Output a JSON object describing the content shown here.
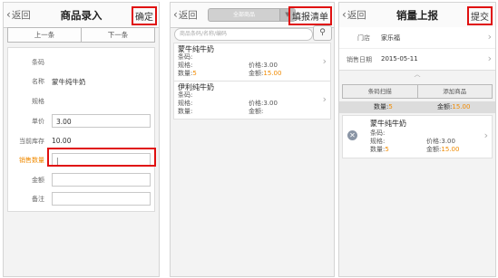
{
  "common": {
    "back_label": "返回"
  },
  "p1": {
    "title": "商品录入",
    "confirm_label": "确定",
    "prev_label": "上一条",
    "next_label": "下一条",
    "fields": {
      "barcode_label": "条码",
      "name_label": "名称",
      "name_value": "蒙牛纯牛奶",
      "spec_label": "规格",
      "price_label": "单价",
      "price_value": "3.00",
      "stock_label": "当前库存",
      "stock_value": "10.00",
      "qty_label": "销售数量",
      "amount_label": "金额",
      "note_label": "备注"
    }
  },
  "p2": {
    "filter_label": "全部商品",
    "submit_label": "填报清单",
    "search_placeholder": "商品条码/名称/编码",
    "items": [
      {
        "name": "蒙牛纯牛奶",
        "barcode_label": "条码:",
        "spec_label": "规格:",
        "qty_label": "数量:",
        "qty": "5",
        "price_label": "价格:",
        "price": "3.00",
        "amount_label": "金额:",
        "amount": "15.00"
      },
      {
        "name": "伊利纯牛奶",
        "barcode_label": "条码:",
        "spec_label": "规格:",
        "qty_label": "数量:",
        "qty": "",
        "price_label": "价格:",
        "price": "3.00",
        "amount_label": "金额:",
        "amount": ""
      }
    ]
  },
  "p3": {
    "title": "销量上报",
    "submit_label": "提交",
    "store_label": "门店",
    "store_value": "家乐福",
    "date_label": "销售日期",
    "date_value": "2015-05-11",
    "scan_label": "条码扫描",
    "add_label": "添加商品",
    "summary_qty_label": "数量:",
    "summary_qty": "5",
    "summary_amount_label": "金额:",
    "summary_amount": "15.00",
    "item": {
      "name": "蒙牛纯牛奶",
      "barcode_label": "条码:",
      "spec_label": "规格:",
      "qty_label": "数量:",
      "qty": "5",
      "price_label": "价格:",
      "price": "3.00",
      "amount_label": "金额:",
      "amount": "15.00"
    }
  },
  "colors": {
    "highlight": "#e01010",
    "accent": "#f08a00"
  }
}
